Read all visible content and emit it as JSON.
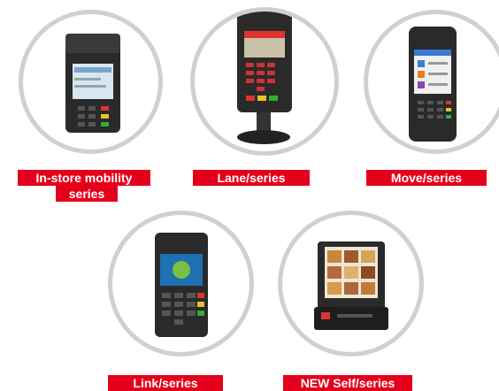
{
  "products": [
    {
      "id": "instore",
      "label_line1": "In-store mobility",
      "label_line2": "series"
    },
    {
      "id": "lane",
      "label_line1": "Lane/series"
    },
    {
      "id": "move",
      "label_line1": "Move/series"
    },
    {
      "id": "link",
      "label_line1": "Link/series"
    },
    {
      "id": "self",
      "label_line1": "NEW Self/series"
    }
  ],
  "colors": {
    "label_bg": "#e4001b",
    "label_text": "#ffffff",
    "circle_border": "#d0d0d0",
    "device_body": "#2a2a2a"
  },
  "icons": [
    "instore-terminal-icon",
    "lane-terminal-icon",
    "move-terminal-icon",
    "link-terminal-icon",
    "self-terminal-icon"
  ]
}
